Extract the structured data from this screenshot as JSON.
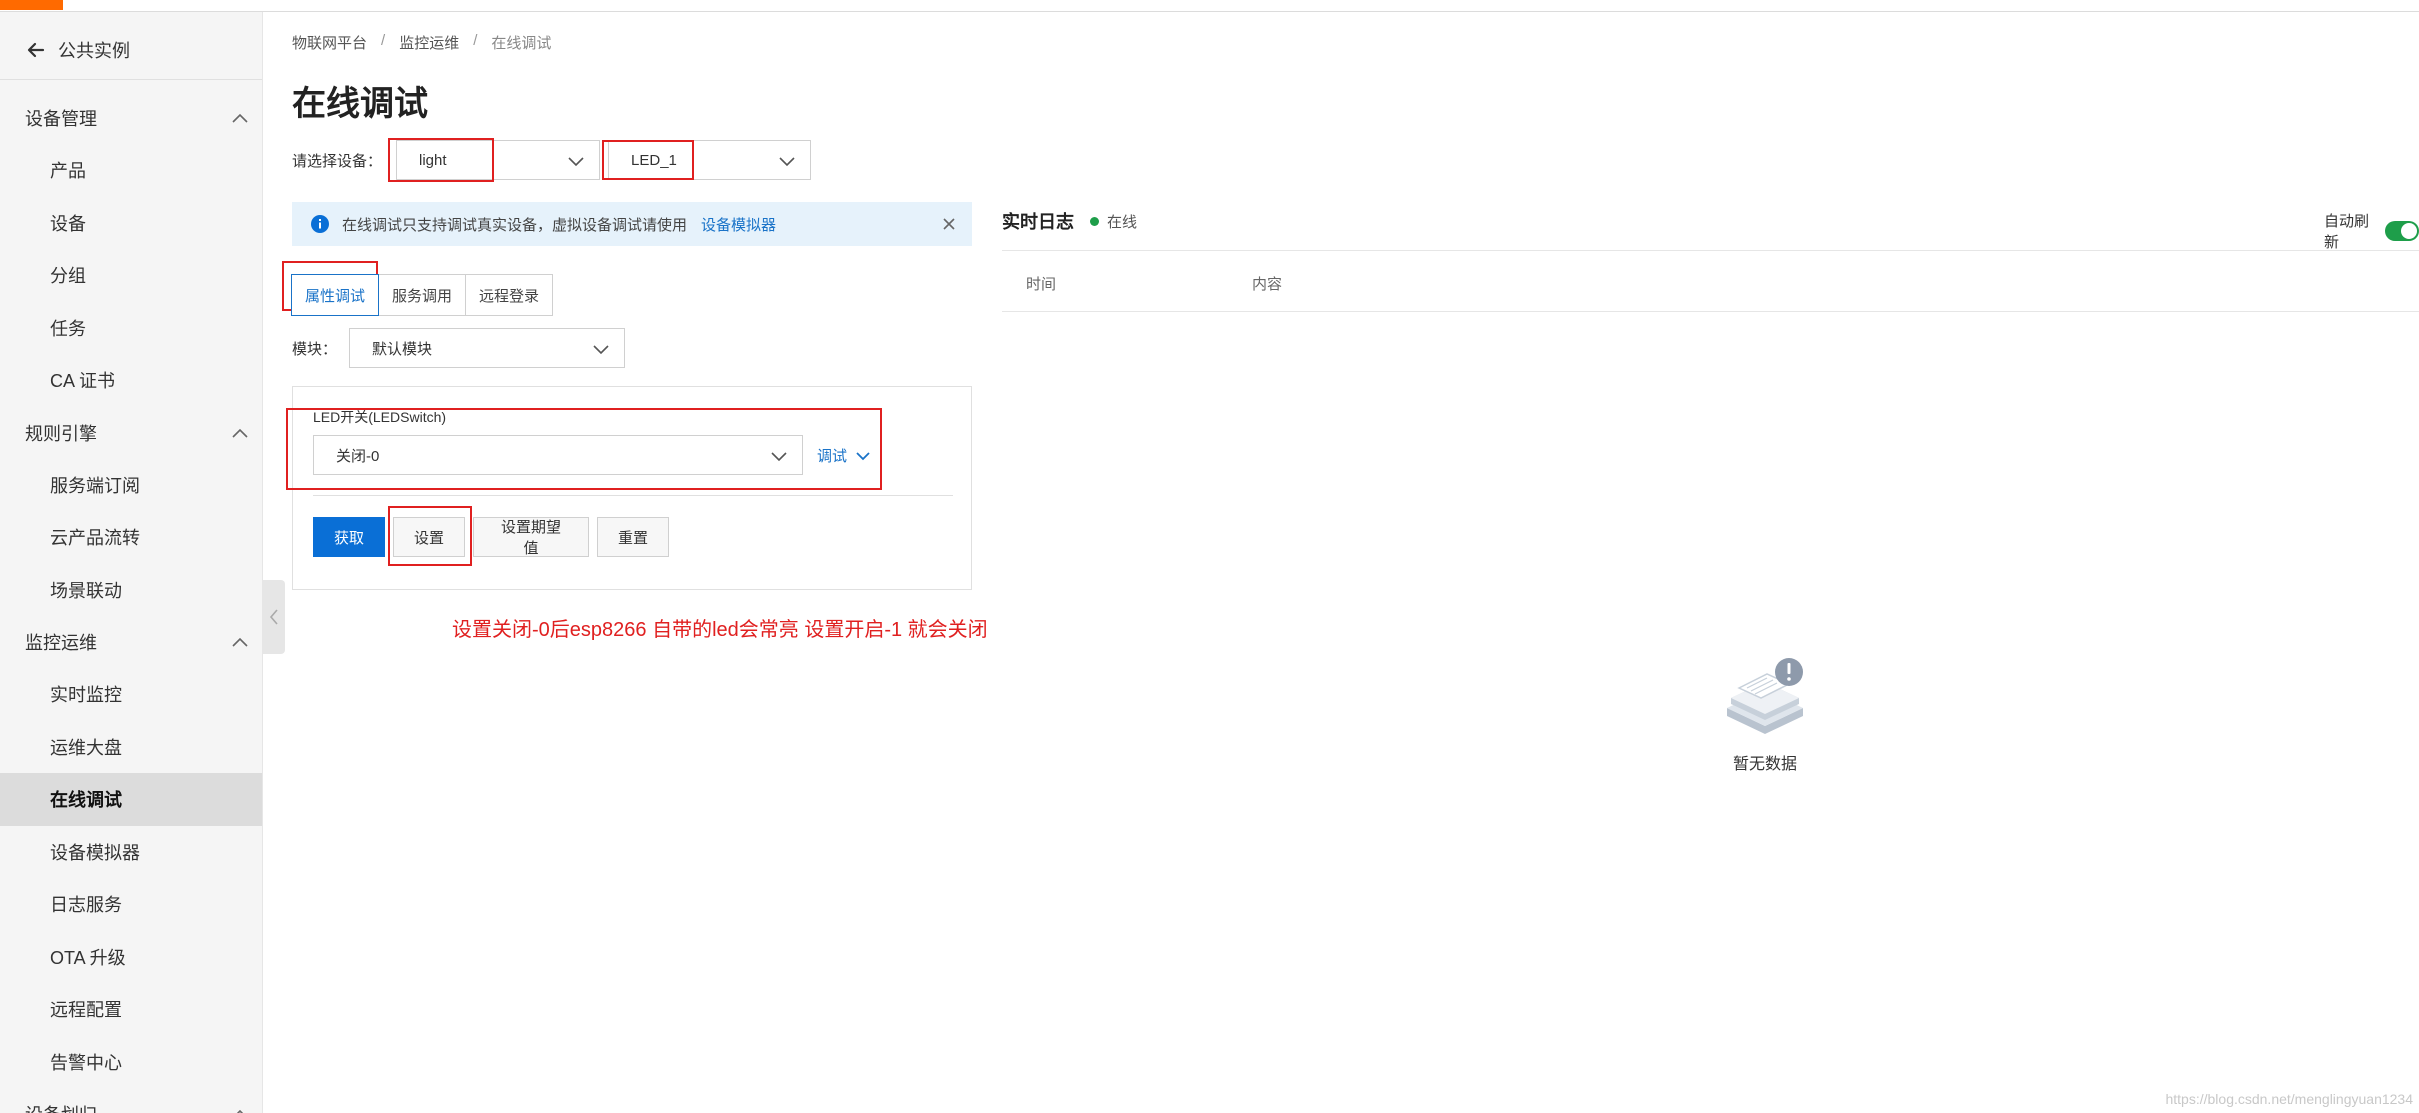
{
  "colors": {
    "accent": "#ff6a00",
    "primary": "#0a6fd6",
    "link": "#1a73c8",
    "highlight_box": "#e02020",
    "online": "#1e9e4a",
    "notice_bg": "#e6f2fb"
  },
  "sidebar": {
    "back_label": "公共实例",
    "groups": [
      {
        "title": "设备管理",
        "items": [
          "产品",
          "设备",
          "分组",
          "任务",
          "CA 证书"
        ]
      },
      {
        "title": "规则引擎",
        "items": [
          "服务端订阅",
          "云产品流转",
          "场景联动"
        ]
      },
      {
        "title": "监控运维",
        "items": [
          "实时监控",
          "运维大盘",
          "在线调试",
          "设备模拟器",
          "日志服务",
          "OTA 升级",
          "远程配置",
          "告警中心"
        ]
      },
      {
        "title": "设备划归",
        "items": []
      }
    ],
    "active_item": "在线调试"
  },
  "breadcrumb": {
    "items": [
      "物联网平台",
      "监控运维",
      "在线调试"
    ],
    "separator": "/"
  },
  "page_title": "在线调试",
  "device_select": {
    "label": "请选择设备：",
    "product": "light",
    "device": "LED_1"
  },
  "notice": {
    "text": "在线调试只支持调试真实设备，虚拟设备调试请使用",
    "link": "设备模拟器"
  },
  "tabs": [
    "属性调试",
    "服务调用",
    "远程登录"
  ],
  "module": {
    "label": "模块：",
    "value": "默认模块"
  },
  "property": {
    "label": "LED开关(LEDSwitch)",
    "value": "关闭-0",
    "debug_link": "调试",
    "buttons": {
      "get": "获取",
      "set": "设置",
      "set_expected": "设置期望值",
      "reset": "重置"
    }
  },
  "annotation": "设置关闭-0后esp8266 自带的led会常亮 设置开启-1 就会关闭",
  "log": {
    "title": "实时日志",
    "status": "在线",
    "auto_refresh_label": "自动刷新",
    "auto_refresh_on": true,
    "columns": [
      "时间",
      "内容"
    ],
    "empty_text": "暂无数据"
  },
  "watermark": "https://blog.csdn.net/menglingyuan1234"
}
